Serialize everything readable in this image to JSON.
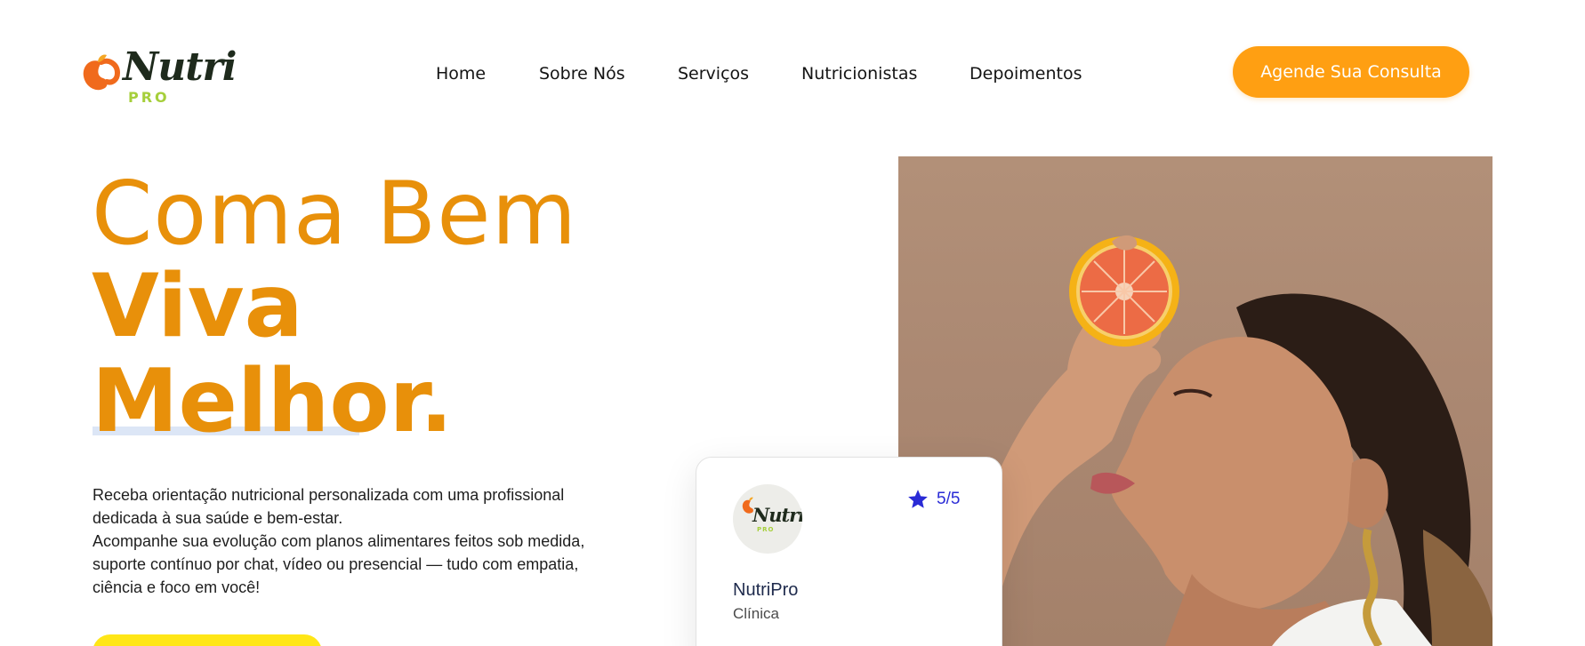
{
  "brand": {
    "name": "Nutri",
    "suffix": "PRO",
    "accent_color": "#ff9f12",
    "title_color": "#e8900a",
    "sub_color": "#a6cf3b"
  },
  "nav": {
    "items": [
      {
        "label": "Home"
      },
      {
        "label": "Sobre Nós"
      },
      {
        "label": "Serviços"
      },
      {
        "label": "Nutricionistas"
      },
      {
        "label": "Depoimentos"
      }
    ],
    "cta_label": "Agende Sua Consulta"
  },
  "hero": {
    "line1": "Coma Bem",
    "line2": "Viva",
    "line3": "Melhor.",
    "description": [
      "Receba orientação nutricional personalizada com uma profissional dedicada à sua saúde e bem-estar.",
      "Acompanhe sua evolução com planos alimentares feitos sob medida, suporte contínuo por chat, vídeo ou presencial — tudo com empatia, ciência e foco em você!"
    ],
    "button_color": "#ffe617"
  },
  "review_card": {
    "logo_name": "Nutri",
    "logo_suffix": "PRO",
    "rating": "5/5",
    "rating_icon": "star-icon",
    "name": "NutriPro",
    "type": "Clínica"
  },
  "photo": {
    "subject": "woman-holding-orange-slice-photo"
  }
}
